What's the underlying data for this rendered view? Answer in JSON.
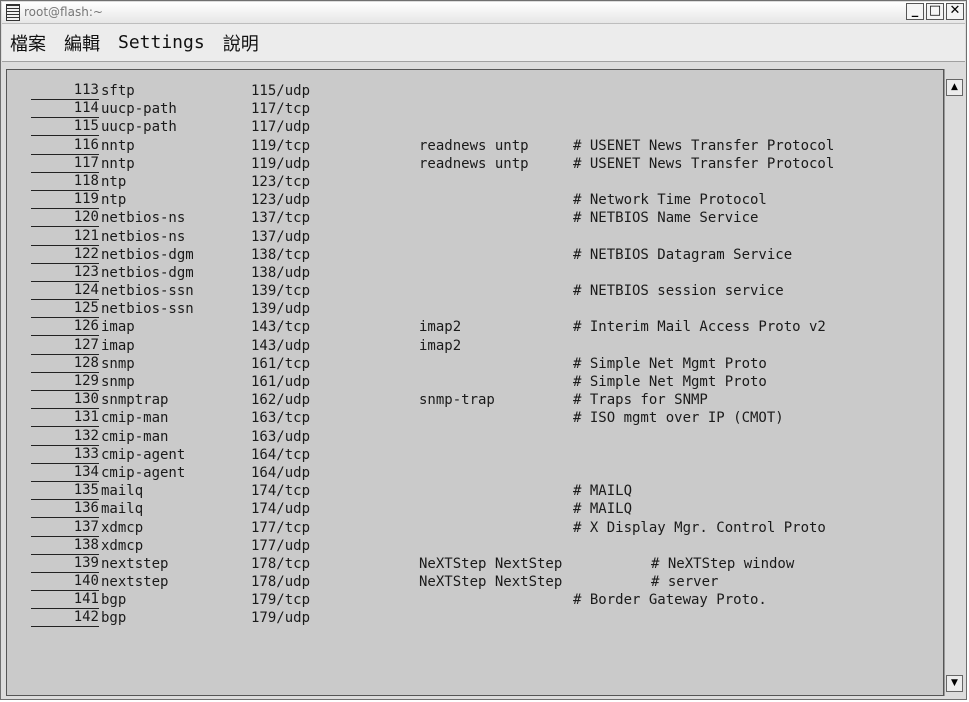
{
  "window": {
    "title": "root@flash:~",
    "buttons": {
      "minimize": "_",
      "maximize": "□",
      "close": "✕"
    }
  },
  "menu": [
    "檔案",
    "編輯",
    "Settings",
    "說明"
  ],
  "terminal": {
    "lines": [
      {
        "num": "113",
        "name": "sftp",
        "port": "115/udp",
        "alias": "",
        "comment": "",
        "tail": ""
      },
      {
        "num": "114",
        "name": "uucp-path",
        "port": "117/tcp",
        "alias": "",
        "comment": "",
        "tail": ""
      },
      {
        "num": "115",
        "name": "uucp-path",
        "port": "117/udp",
        "alias": "",
        "comment": "",
        "tail": ""
      },
      {
        "num": "116",
        "name": "nntp",
        "port": "119/tcp",
        "alias": "readnews untp",
        "comment": "# USENET News Transfer Protocol",
        "tail": ""
      },
      {
        "num": "117",
        "name": "nntp",
        "port": "119/udp",
        "alias": "readnews untp",
        "comment": "# USENET News Transfer Protocol",
        "tail": ""
      },
      {
        "num": "118",
        "name": "ntp",
        "port": "123/tcp",
        "alias": "",
        "comment": "",
        "tail": ""
      },
      {
        "num": "119",
        "name": "ntp",
        "port": "123/udp",
        "alias": "",
        "comment": "# Network Time Protocol",
        "tail": ""
      },
      {
        "num": "120",
        "name": "netbios-ns",
        "port": "137/tcp",
        "alias": "",
        "comment": "# NETBIOS Name Service",
        "tail": ""
      },
      {
        "num": "121",
        "name": "netbios-ns",
        "port": "137/udp",
        "alias": "",
        "comment": "",
        "tail": ""
      },
      {
        "num": "122",
        "name": "netbios-dgm",
        "port": "138/tcp",
        "alias": "",
        "comment": "# NETBIOS Datagram Service",
        "tail": ""
      },
      {
        "num": "123",
        "name": "netbios-dgm",
        "port": "138/udp",
        "alias": "",
        "comment": "",
        "tail": ""
      },
      {
        "num": "124",
        "name": "netbios-ssn",
        "port": "139/tcp",
        "alias": "",
        "comment": "# NETBIOS session service",
        "tail": ""
      },
      {
        "num": "125",
        "name": "netbios-ssn",
        "port": "139/udp",
        "alias": "",
        "comment": "",
        "tail": ""
      },
      {
        "num": "126",
        "name": "imap",
        "port": "143/tcp",
        "alias": "imap2",
        "comment": "# Interim Mail Access Proto v2",
        "tail": ""
      },
      {
        "num": "127",
        "name": "imap",
        "port": "143/udp",
        "alias": "imap2",
        "comment": "",
        "tail": ""
      },
      {
        "num": "128",
        "name": "snmp",
        "port": "161/tcp",
        "alias": "",
        "comment": "# Simple Net Mgmt Proto",
        "tail": ""
      },
      {
        "num": "129",
        "name": "snmp",
        "port": "161/udp",
        "alias": "",
        "comment": "# Simple Net Mgmt Proto",
        "tail": ""
      },
      {
        "num": "130",
        "name": "snmptrap",
        "port": "162/udp",
        "alias": "snmp-trap",
        "comment": "# Traps for SNMP",
        "tail": ""
      },
      {
        "num": "131",
        "name": "cmip-man",
        "port": "163/tcp",
        "alias": "",
        "comment": "# ISO mgmt over IP (CMOT)",
        "tail": ""
      },
      {
        "num": "132",
        "name": "cmip-man",
        "port": "163/udp",
        "alias": "",
        "comment": "",
        "tail": ""
      },
      {
        "num": "133",
        "name": "cmip-agent",
        "port": "164/tcp",
        "alias": "",
        "comment": "",
        "tail": ""
      },
      {
        "num": "134",
        "name": "cmip-agent",
        "port": "164/udp",
        "alias": "",
        "comment": "",
        "tail": ""
      },
      {
        "num": "135",
        "name": "mailq",
        "port": "174/tcp",
        "alias": "",
        "comment": "# MAILQ",
        "tail": ""
      },
      {
        "num": "136",
        "name": "mailq",
        "port": "174/udp",
        "alias": "",
        "comment": "# MAILQ",
        "tail": ""
      },
      {
        "num": "137",
        "name": "xdmcp",
        "port": "177/tcp",
        "alias": "",
        "comment": "# X Display Mgr. Control Proto",
        "tail": ""
      },
      {
        "num": "138",
        "name": "xdmcp",
        "port": "177/udp",
        "alias": "",
        "comment": "",
        "tail": ""
      },
      {
        "num": "139",
        "name": "nextstep",
        "port": "178/tcp",
        "alias": "NeXTStep NextStep",
        "comment": "",
        "tail": "# NeXTStep window"
      },
      {
        "num": "140",
        "name": "nextstep",
        "port": "178/udp",
        "alias": "NeXTStep NextStep",
        "comment": "",
        "tail": "# server"
      },
      {
        "num": "141",
        "name": "bgp",
        "port": "179/tcp",
        "alias": "",
        "comment": "# Border Gateway Proto.",
        "tail": ""
      },
      {
        "num": "142",
        "name": "bgp",
        "port": "179/udp",
        "alias": "",
        "comment": "",
        "tail": ""
      }
    ]
  },
  "scrollbar": {
    "up_arrow": "▲",
    "down_arrow": "▼"
  }
}
